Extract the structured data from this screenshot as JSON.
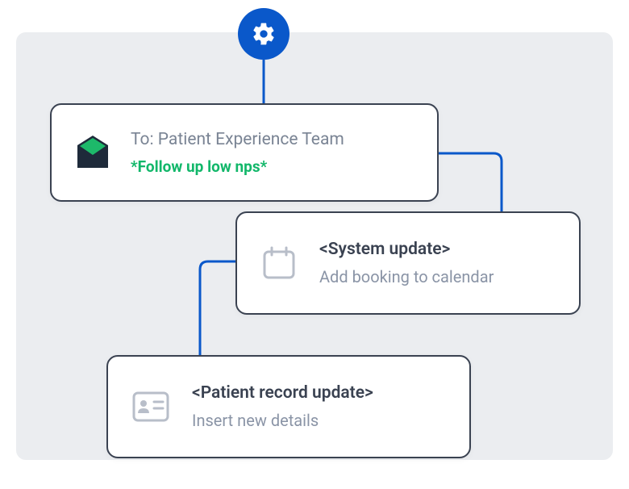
{
  "card1": {
    "to": "To: Patient Experience Team",
    "tag": "*Follow up low nps*"
  },
  "card2": {
    "title": "<System update>",
    "subtitle": "Add booking to calendar"
  },
  "card3": {
    "title": "<Patient record update>",
    "subtitle": "Insert new details"
  },
  "colors": {
    "blue": "#0A58CA",
    "green": "#12B76A",
    "envelope_dark": "#1E2A3A",
    "envelope_green": "#1DB96A",
    "gray_icon": "#B8BEC9",
    "dark_stroke": "#3A4251"
  }
}
